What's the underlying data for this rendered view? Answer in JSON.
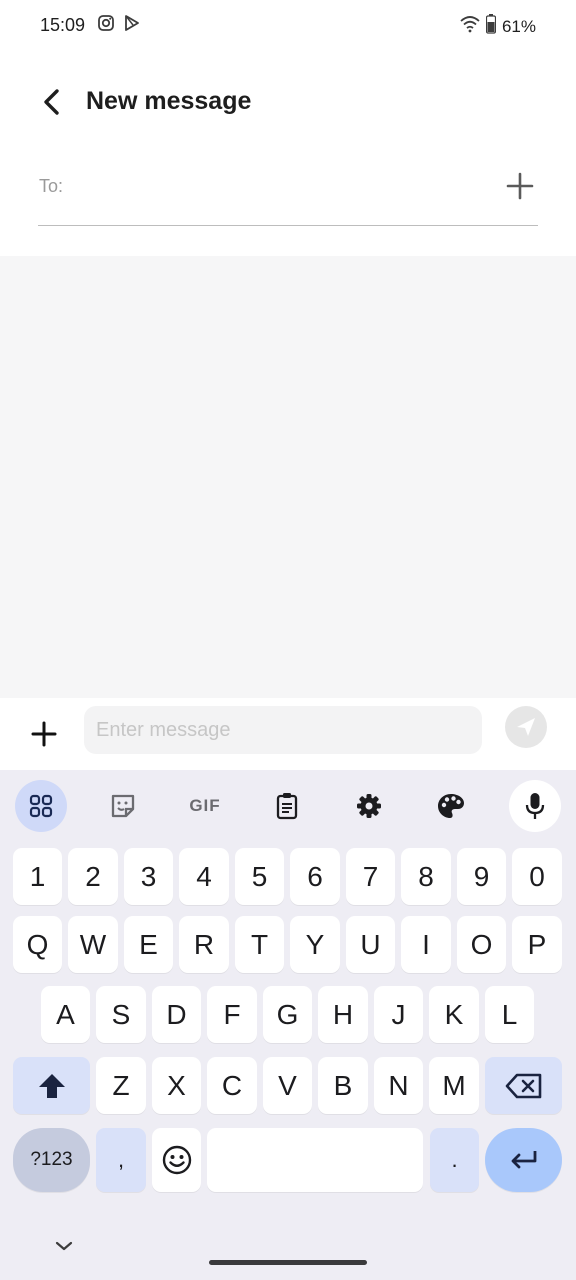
{
  "status_bar": {
    "time": "15:09",
    "left_icons": [
      "instagram-icon",
      "play-store-icon"
    ],
    "right_icons": [
      "wifi-icon",
      "battery-icon"
    ],
    "battery_percent": "61%"
  },
  "header": {
    "title": "New message",
    "back_icon": "back-arrow-icon"
  },
  "recipient": {
    "label": "To:",
    "value": "",
    "add_icon": "plus-icon"
  },
  "compose": {
    "attach_icon": "plus-icon",
    "placeholder": "Enter message",
    "value": "",
    "send_icon": "send-icon"
  },
  "keyboard": {
    "toolbar": [
      {
        "name": "apps-grid-icon",
        "active": true
      },
      {
        "name": "sticker-icon"
      },
      {
        "name": "gif-icon",
        "label": "GIF"
      },
      {
        "name": "clipboard-icon"
      },
      {
        "name": "settings-gear-icon"
      },
      {
        "name": "palette-icon"
      },
      {
        "name": "microphone-icon"
      }
    ],
    "rows": [
      [
        "1",
        "2",
        "3",
        "4",
        "5",
        "6",
        "7",
        "8",
        "9",
        "0"
      ],
      [
        "Q",
        "W",
        "E",
        "R",
        "T",
        "Y",
        "U",
        "I",
        "O",
        "P"
      ],
      [
        "A",
        "S",
        "D",
        "F",
        "G",
        "H",
        "J",
        "K",
        "L"
      ],
      [
        "Z",
        "X",
        "C",
        "V",
        "B",
        "N",
        "M"
      ]
    ],
    "shift_icon": "shift-arrow-icon",
    "backspace_icon": "backspace-icon",
    "symbols_label": "?123",
    "comma_label": ",",
    "emoji_icon": "emoji-icon",
    "space_label": "",
    "period_label": ".",
    "enter_icon": "enter-icon",
    "hide_icon": "chevron-down-icon"
  },
  "colors": {
    "accent_light": "#cfd9f8",
    "function_key": "#d9e1f9",
    "enter_key": "#a9c8fb",
    "keyboard_bg": "#eeedf4",
    "conversation_bg": "#f6f6f7"
  }
}
